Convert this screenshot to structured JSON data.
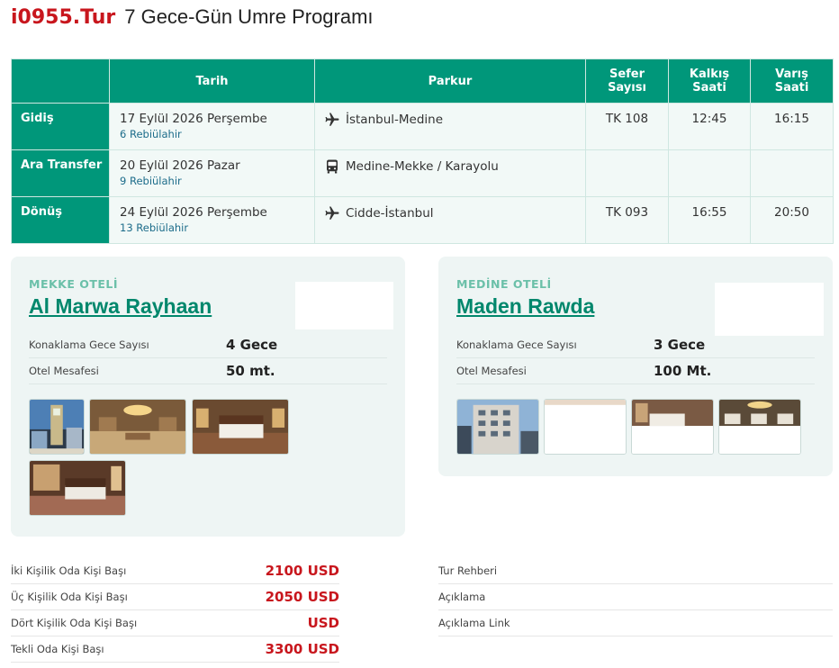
{
  "header": {
    "brand": "i0955.Tur",
    "title": "7 Gece-Gün Umre Programı"
  },
  "flights": {
    "columns": [
      "",
      "Tarih",
      "Parkur",
      "Sefer Sayısı",
      "Kalkış Saati",
      "Varış Saati"
    ],
    "rows": [
      {
        "label": "Gidiş",
        "date": "17 Eylül 2026 Perşembe",
        "hijri": "6 Rebiülahir",
        "route_icon": "airplane-icon",
        "route": "İstanbul-Medine",
        "flight_no": "TK 108",
        "departure": "12:45",
        "arrival": "16:15"
      },
      {
        "label": "Ara Transfer",
        "date": "20 Eylül 2026 Pazar",
        "hijri": "9 Rebiülahir",
        "route_icon": "bus-icon",
        "route": "Medine-Mekke / Karayolu",
        "flight_no": "",
        "departure": "",
        "arrival": ""
      },
      {
        "label": "Dönüş",
        "date": "24 Eylül 2026 Perşembe",
        "hijri": "13 Rebiülahir",
        "route_icon": "airplane-icon",
        "route": "Cidde-İstanbul",
        "flight_no": "TK 093",
        "departure": "16:55",
        "arrival": "20:50"
      }
    ]
  },
  "hotels": {
    "mekke": {
      "label": "MEKKE OTELİ",
      "name": "Al Marwa Rayhaan",
      "nights_label": "Konaklama Gece Sayısı",
      "nights_value": "4 Gece",
      "distance_label": "Otel Mesafesi",
      "distance_value": "50 mt.",
      "photos": [
        "photo-clock-tower",
        "photo-lobby",
        "photo-room",
        "photo-suite"
      ]
    },
    "medine": {
      "label": "MEDİNE OTELİ",
      "name": "Maden Rawda",
      "nights_label": "Konaklama Gece Sayısı",
      "nights_value": "3 Gece",
      "distance_label": "Otel Mesafesi",
      "distance_value": "100 Mt.",
      "photos": [
        "photo-building",
        "photo-blank",
        "photo-room",
        "photo-restaurant"
      ]
    }
  },
  "prices": [
    {
      "label": "İki Kişilik Oda Kişi Başı",
      "value": "2100 USD"
    },
    {
      "label": "Üç Kişilik Oda Kişi Başı",
      "value": "2050 USD"
    },
    {
      "label": "Dört Kişilik Oda Kişi Başı",
      "value": "USD"
    },
    {
      "label": "Tekli Oda Kişi Başı",
      "value": "3300 USD"
    }
  ],
  "extras": [
    {
      "label": "Tur Rehberi"
    },
    {
      "label": "Açıklama"
    },
    {
      "label": "Açıklama Link"
    }
  ],
  "colors": {
    "brand_red": "#c8161d",
    "teal": "#00977a",
    "hotel_name": "#00876c",
    "card_bg": "#eef5f4"
  }
}
